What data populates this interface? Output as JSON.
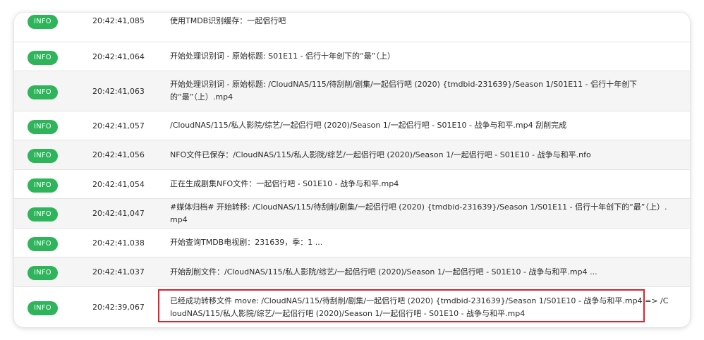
{
  "log": {
    "rows": [
      {
        "level": "INFO",
        "time": "20:42:41,085",
        "message": "使用TMDB识别缓存：一起侣行吧"
      },
      {
        "level": "INFO",
        "time": "20:42:41,064",
        "message": "开始处理识别词 - 原始标题: S01E11 - 侣行十年创下的“最”（上）"
      },
      {
        "level": "INFO",
        "time": "20:42:41,063",
        "message": "开始处理识别词 - 原始标题: /CloudNAS/115/待刮削/剧集/一起侣行吧 (2020) {tmdbid-231639}/Season 1/S01E11 - 侣行十年创下的“最”（上）.mp4"
      },
      {
        "level": "INFO",
        "time": "20:42:41,057",
        "message": "/CloudNAS/115/私人影院/综艺/一起侣行吧 (2020)/Season 1/一起侣行吧 - S01E10 - 战争与和平.mp4 刮削完成"
      },
      {
        "level": "INFO",
        "time": "20:42:41,056",
        "message": "NFO文件已保存：/CloudNAS/115/私人影院/综艺/一起侣行吧 (2020)/Season 1/一起侣行吧 - S01E10 - 战争与和平.nfo"
      },
      {
        "level": "INFO",
        "time": "20:42:41,054",
        "message": "正在生成剧集NFO文件：一起侣行吧 - S01E10 - 战争与和平.mp4"
      },
      {
        "level": "INFO",
        "time": "20:42:41,047",
        "message": "#媒体归档# 开始转移: /CloudNAS/115/待刮削/剧集/一起侣行吧 (2020) {tmdbid-231639}/Season 1/S01E11 - 侣行十年创下的“最”（上）.mp4"
      },
      {
        "level": "INFO",
        "time": "20:42:41,038",
        "message": "开始查询TMDB电视剧：231639，季：1 ..."
      },
      {
        "level": "INFO",
        "time": "20:42:41,037",
        "message": "开始刮削文件：/CloudNAS/115/私人影院/综艺/一起侣行吧 (2020)/Season 1/一起侣行吧 - S01E10 - 战争与和平.mp4 ..."
      },
      {
        "level": "INFO",
        "time": "20:42:39,067",
        "message": "已经成功转移文件 move: /CloudNAS/115/待刮削/剧集/一起侣行吧 (2020) {tmdbid-231639}/Season 1/S01E10 - 战争与和平.mp4 => /CloudNAS/115/私人影院/综艺/一起侣行吧 (2020)/Season 1/一起侣行吧 - S01E10 - 战争与和平.mp4"
      }
    ]
  },
  "colors": {
    "badge_bg": "#2fb45c",
    "highlight_border": "#e0202a",
    "alt_row_bg": "#f5f5f6"
  }
}
